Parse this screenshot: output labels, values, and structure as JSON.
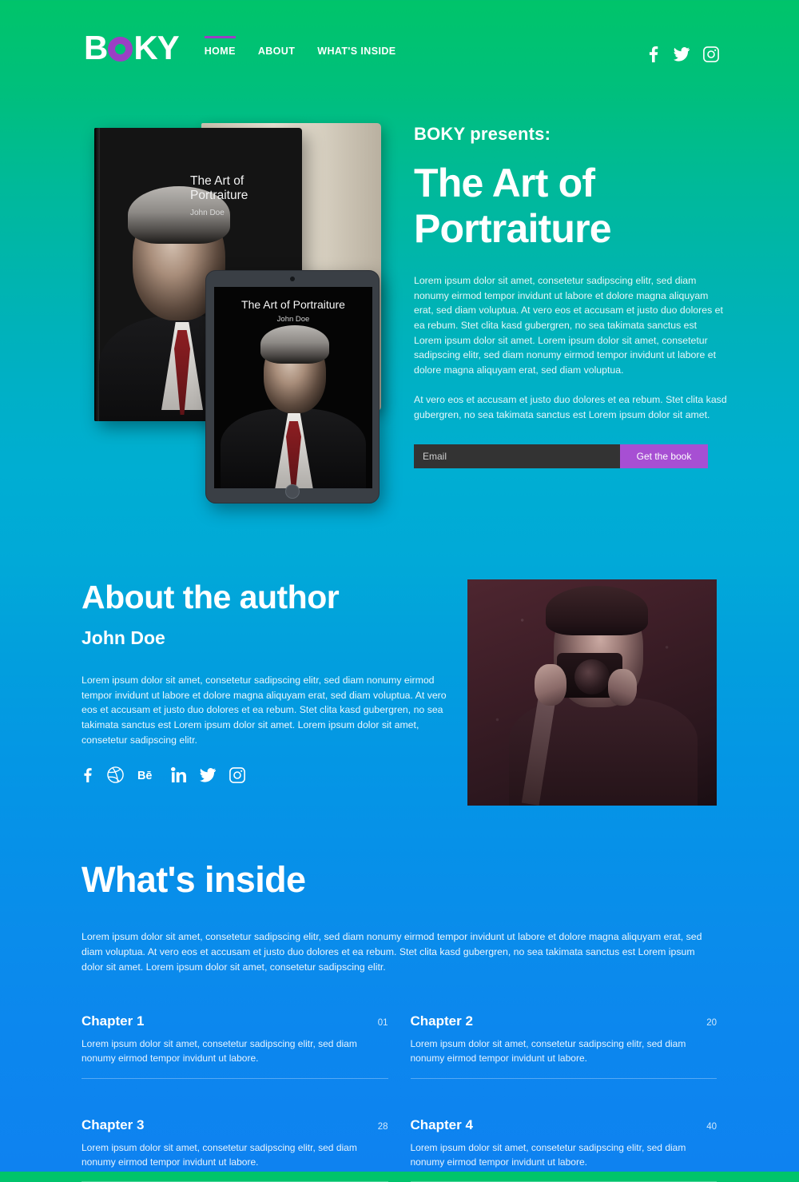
{
  "header": {
    "logo": {
      "before": "B",
      "ring": "O",
      "after": "KY",
      "full": "BOKY"
    },
    "nav": [
      {
        "label": "HOME",
        "active": true
      },
      {
        "label": "ABOUT",
        "active": false
      },
      {
        "label": "WHAT'S INSIDE",
        "active": false
      }
    ],
    "social": [
      {
        "name": "facebook-icon"
      },
      {
        "name": "twitter-icon"
      },
      {
        "name": "instagram-icon"
      }
    ]
  },
  "hero": {
    "kicker": "BOKY presents:",
    "title": "The Art of Portraiture",
    "paragraph1": "Lorem ipsum dolor sit amet, consetetur sadipscing elitr, sed diam nonumy eirmod tempor invidunt ut labore et dolore magna aliquyam erat, sed diam voluptua. At vero eos et accusam et justo duo dolores et ea rebum. Stet clita kasd gubergren, no sea takimata sanctus est Lorem ipsum dolor sit amet. Lorem ipsum dolor sit amet, consetetur sadipscing elitr, sed diam nonumy eirmod tempor invidunt ut labore et dolore magna aliquyam erat, sed diam voluptua.",
    "paragraph2": "At vero eos et accusam et justo duo dolores et ea rebum. Stet clita kasd gubergren, no sea takimata sanctus est Lorem ipsum dolor sit amet.",
    "email_placeholder": "Email",
    "email_value": "",
    "cta_label": "Get the book",
    "book": {
      "cover_title": "The Art of Portraiture",
      "cover_author": "John Doe",
      "tablet_title": "The Art of Portraiture",
      "tablet_author": "John Doe"
    }
  },
  "author": {
    "heading": "About the author",
    "name": "John Doe",
    "bio": "Lorem ipsum dolor sit amet, consetetur sadipscing elitr, sed diam nonumy eirmod tempor invidunt ut labore et dolore magna aliquyam erat, sed diam voluptua. At vero eos et accusam et justo duo dolores et ea rebum. Stet clita kasd gubergren, no sea takimata sanctus est Lorem ipsum dolor sit amet. Lorem ipsum dolor sit amet, consetetur sadipscing elitr.",
    "social": [
      {
        "name": "facebook-icon"
      },
      {
        "name": "dribbble-icon"
      },
      {
        "name": "behance-icon"
      },
      {
        "name": "linkedin-icon"
      },
      {
        "name": "twitter-icon"
      },
      {
        "name": "instagram-icon"
      }
    ]
  },
  "inside": {
    "heading": "What's inside",
    "intro": "Lorem ipsum dolor sit amet, consetetur sadipscing elitr, sed diam nonumy eirmod tempor invidunt ut labore et dolore magna aliquyam erat, sed diam voluptua. At vero eos et accusam et justo duo dolores et ea rebum. Stet clita kasd gubergren, no sea takimata sanctus est Lorem ipsum dolor sit amet. Lorem ipsum dolor sit amet, consetetur sadipscing elitr.",
    "chapters": [
      {
        "title": "Chapter 1",
        "page": "01",
        "desc": "Lorem ipsum dolor sit amet, consetetur sadipscing elitr, sed diam nonumy eirmod tempor invidunt ut labore."
      },
      {
        "title": "Chapter 2",
        "page": "20",
        "desc": "Lorem ipsum dolor sit amet, consetetur sadipscing elitr, sed diam nonumy eirmod tempor invidunt ut labore."
      },
      {
        "title": "Chapter 3",
        "page": "28",
        "desc": "Lorem ipsum dolor sit amet, consetetur sadipscing elitr, sed diam nonumy eirmod tempor invidunt ut labore."
      },
      {
        "title": "Chapter 4",
        "page": "40",
        "desc": "Lorem ipsum dolor sit amet, consetetur sadipscing elitr, sed diam nonumy eirmod tempor invidunt ut labore."
      }
    ]
  },
  "colors": {
    "gradient_top": "#00c46a",
    "gradient_mid": "#00aed2",
    "gradient_bottom": "#0e82f0",
    "accent_purple": "#9b3fc4",
    "button_purple": "#a74fd3",
    "input_dark": "#333333"
  }
}
